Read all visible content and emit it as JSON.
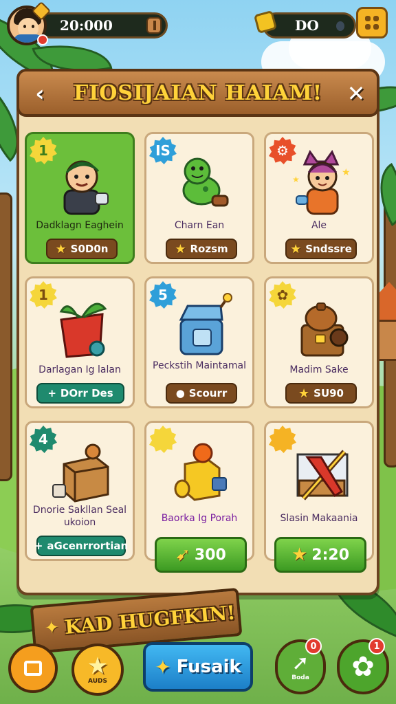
{
  "hud": {
    "coins": "20:000",
    "gems": "DO"
  },
  "panel": {
    "title": "FIOSIJAIAN HAIAM!",
    "back_icon": "chevron-left-icon",
    "close_icon": "close-icon"
  },
  "items": [
    {
      "num": "1",
      "name": "Dadklagn Eaghein",
      "price": "S0D0n",
      "price_icon": "star-icon",
      "featured": true,
      "badge_color": "#f5d63a"
    },
    {
      "num": "IS",
      "name": "Charn Ean",
      "price": "Rozsm",
      "price_icon": "star-icon",
      "badge_color": "#2f9fd9"
    },
    {
      "num": "",
      "name": "Ale",
      "price": "Sndssre",
      "price_icon": "star-icon",
      "badge_color": "#e8502a"
    },
    {
      "num": "1",
      "name": "Darlagan Ig lalan",
      "price": "DOrr Des",
      "price_icon": "plus-icon",
      "badge_color": "#f5d63a",
      "price_style": "teal"
    },
    {
      "num": "5",
      "name": "Peckstih Maintamal",
      "price": "Scourr",
      "price_icon": "dot-icon",
      "badge_color": "#2f9fd9"
    },
    {
      "num": "",
      "name": "Madim Sake",
      "price": "SU90",
      "price_icon": "star-icon",
      "badge_color": "#f5d63a"
    },
    {
      "num": "4",
      "name": "Dnorie Sakllan Seal ukoion",
      "price": "aGcenrrortian",
      "price_icon": "plus-icon",
      "badge_color": "#1f8a6e",
      "price_style": "teal"
    },
    {
      "num": "",
      "name": "Baorka Ig Porah",
      "price": "300",
      "price_icon": "leaf-icon",
      "badge_color": "#f5d63a",
      "price_style": "green"
    },
    {
      "num": "",
      "name": "Slasin Makaania",
      "price": "2:20",
      "price_icon": "star-icon",
      "badge_color": "#f5b324",
      "price_style": "green"
    }
  ],
  "banner": {
    "text": "KAD HUGFKIN!"
  },
  "bottom": {
    "stars_label": "AUDS",
    "main_label": "Fusaik",
    "share_label": "Boda",
    "share_badge": "0",
    "settings_badge": "1"
  }
}
